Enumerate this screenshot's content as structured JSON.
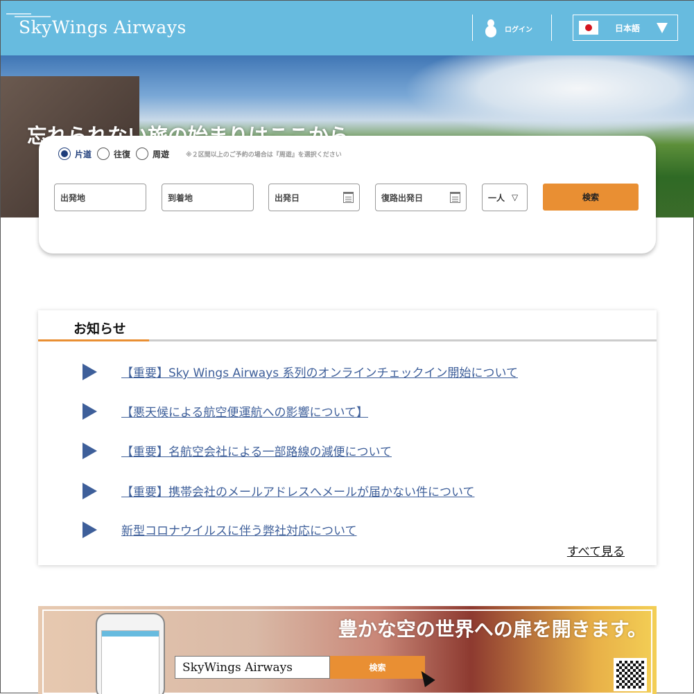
{
  "header": {
    "logo": "SkyWings Airways",
    "login_label": "ログイン",
    "language": "日本語"
  },
  "hero": {
    "title": "忘れられない旅の始まりはここから。"
  },
  "search": {
    "trip_types": [
      {
        "label": "片道",
        "selected": true
      },
      {
        "label": "往復",
        "selected": false
      },
      {
        "label": "周遊",
        "selected": false
      }
    ],
    "note": "※２区間以上のご予約の場合は『周遊』を選択ください",
    "origin_placeholder": "出発地",
    "destination_placeholder": "到着地",
    "depart_date_placeholder": "出発日",
    "return_date_placeholder": "復路出発日",
    "passengers": "一人",
    "search_label": "検索"
  },
  "news": {
    "title": "お知らせ",
    "items": [
      "【重要】Sky Wings Airways 系列のオンラインチェックイン開始について",
      "【悪天候による航空便運航への影響について】",
      "【重要】名航空会社による一部路線の減便について",
      "【重要】携帯会社のメールアドレスへメールが届かない件について",
      "新型コロナウイルスに伴う弊社対応について"
    ],
    "see_all": "すべて見る"
  },
  "banner": {
    "title": "豊かな空の世界への扉を開きます。",
    "search_value": "SkyWings Airways",
    "search_label": "検索"
  },
  "colors": {
    "header": "#67bbdf",
    "accent": "#e98f33",
    "link": "#3e5f9a"
  }
}
